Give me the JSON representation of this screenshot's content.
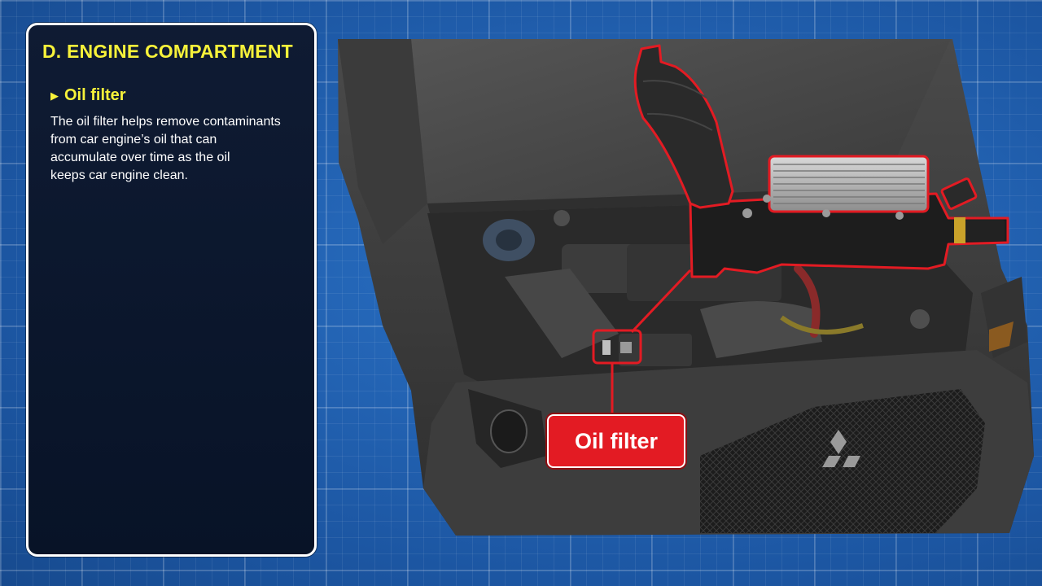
{
  "panel": {
    "section_title": "D. ENGINE COMPARTMENT",
    "topic_bullet": "▶",
    "topic_title": "Oil filter",
    "description_lines": [
      "The oil filter helps remove contaminants",
      "from car engine’s oil that can",
      "accumulate over time as the oil",
      "keeps car engine clean."
    ]
  },
  "callout": {
    "label": "Oil filter"
  },
  "colors": {
    "title_yellow": "#f7f23a",
    "highlight_red": "#e31b23",
    "panel_bg": "#0b162d",
    "background_blue": "#1f5fb0"
  }
}
